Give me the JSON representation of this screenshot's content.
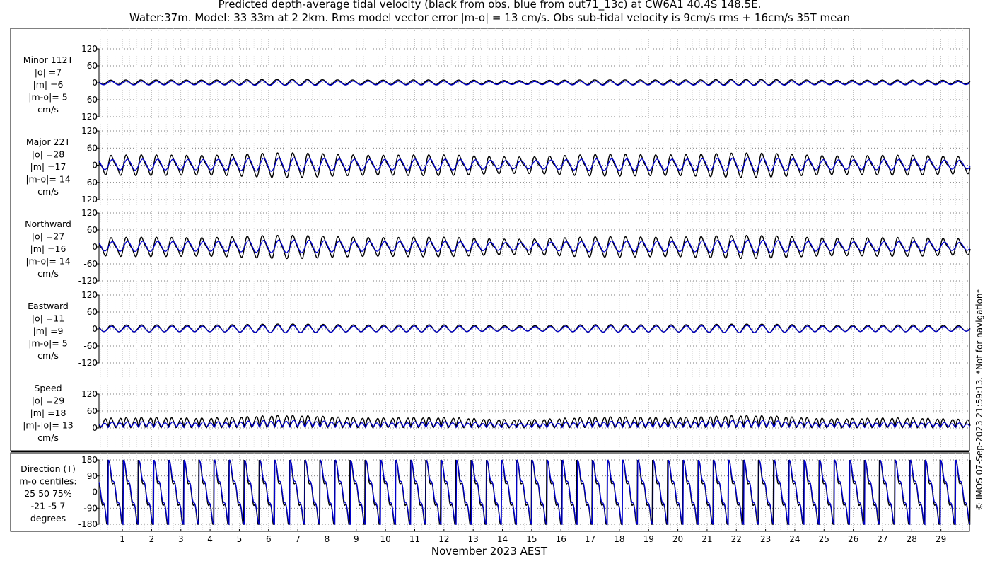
{
  "title": {
    "line1": "Predicted depth-average tidal velocity (black from obs, blue from out71_13c) at CW6A1 40.4S 148.5E.",
    "line2": "Water:37m. Model: 33 33m at 2 2km. Rms model vector error |m-o| = 13 cm/s. Obs sub-tidal velocity is 9cm/s rms + 16cm/s 35T mean"
  },
  "copyright": "© IMOS 07-Sep-2023 21:59:13. *Not for navigation*",
  "colors": {
    "obs": "#000000",
    "model": "#0000cc",
    "grid": "#b0b0b0"
  },
  "chart_data": {
    "type": "line",
    "xlabel": "November 2023 AEST",
    "x_ticks": [
      "1",
      "2",
      "3",
      "4",
      "5",
      "6",
      "7",
      "8",
      "9",
      "10",
      "11",
      "12",
      "13",
      "14",
      "15",
      "16",
      "17",
      "18",
      "19",
      "20",
      "21",
      "22",
      "23",
      "24",
      "25",
      "26",
      "27",
      "28",
      "29"
    ],
    "x_range_days": [
      0.2,
      30.0
    ],
    "series_names": [
      "obs",
      "model"
    ],
    "panels": [
      {
        "label_lines": [
          "Minor 112T",
          "|o| =7",
          "|m| =6",
          "|m-o|= 5",
          "cm/s"
        ],
        "ylim": [
          -120,
          120
        ],
        "yticks": [
          "120",
          "60",
          "0",
          "-60",
          "-120"
        ],
        "obs_rms": 7,
        "model_rms": 6
      },
      {
        "label_lines": [
          "Major 22T",
          "|o| =28",
          "|m| =17",
          "|m-o|= 14",
          "cm/s"
        ],
        "ylim": [
          -120,
          120
        ],
        "yticks": [
          "120",
          "60",
          "0",
          "-60",
          "-120"
        ],
        "obs_rms": 28,
        "model_rms": 17
      },
      {
        "label_lines": [
          "Northward",
          "|o| =27",
          "|m| =16",
          "|m-o|= 14",
          "cm/s"
        ],
        "ylim": [
          -120,
          120
        ],
        "yticks": [
          "120",
          "60",
          "0",
          "-60",
          "-120"
        ],
        "obs_rms": 27,
        "model_rms": 16
      },
      {
        "label_lines": [
          "Eastward",
          "|o| =11",
          "|m| =9",
          "|m-o|= 5",
          "cm/s"
        ],
        "ylim": [
          -120,
          120
        ],
        "yticks": [
          "120",
          "60",
          "0",
          "-60",
          "-120"
        ],
        "obs_rms": 11,
        "model_rms": 9
      },
      {
        "label_lines": [
          "Speed",
          "|o| =29",
          "|m| =18",
          "|m|-|o|= 13",
          "cm/s"
        ],
        "ylim": [
          0,
          120
        ],
        "yticks": [
          "120",
          "60",
          "0"
        ],
        "obs_rms": 29,
        "model_rms": 18
      },
      {
        "label_lines": [
          "Direction (T)",
          "m-o centiles:",
          "25  50  75%",
          "-21  -5   7",
          "degrees"
        ],
        "ylim": [
          -180,
          180
        ],
        "yticks": [
          "180",
          "90",
          "0",
          "-90",
          "-180"
        ]
      }
    ]
  }
}
